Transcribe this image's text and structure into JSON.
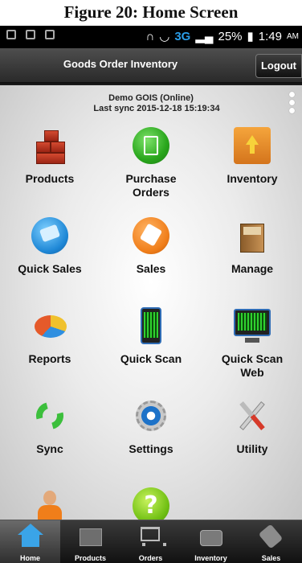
{
  "caption": "Figure 20: Home Screen",
  "statusbar": {
    "network": "3G",
    "battery": "25%",
    "time": "1:49",
    "ampm": "AM"
  },
  "header": {
    "title": "Goods Order Inventory",
    "logout_label": "Logout"
  },
  "account": {
    "line1": "Demo  GOIS (Online)",
    "line2": "Last sync 2015-12-18 15:19:34"
  },
  "tiles": [
    {
      "label": "Products",
      "icon": "boxes-icon"
    },
    {
      "label": "Purchase\nOrders",
      "icon": "calculator-icon"
    },
    {
      "label": "Inventory",
      "icon": "box-arrow-icon"
    },
    {
      "label": "Quick Sales",
      "icon": "sale-tag-icon"
    },
    {
      "label": "Sales",
      "icon": "price-tag-icon"
    },
    {
      "label": "Manage",
      "icon": "cabinet-icon"
    },
    {
      "label": "Reports",
      "icon": "pie-chart-icon"
    },
    {
      "label": "Quick Scan",
      "icon": "barcode-scanner-icon"
    },
    {
      "label": "Quick Scan\nWeb",
      "icon": "barcode-monitor-icon"
    },
    {
      "label": "Sync",
      "icon": "sync-icon"
    },
    {
      "label": "Settings",
      "icon": "gear-icon"
    },
    {
      "label": "Utility",
      "icon": "tools-icon"
    }
  ],
  "bottom_nav": [
    {
      "label": "Home",
      "icon": "home-icon",
      "active": true
    },
    {
      "label": "Products",
      "icon": "box-icon"
    },
    {
      "label": "Orders",
      "icon": "cart-icon"
    },
    {
      "label": "Inventory",
      "icon": "tray-icon"
    },
    {
      "label": "Sales",
      "icon": "tag-icon"
    }
  ],
  "colors": {
    "titlebar": "#3a3a3a",
    "accent": "#3aa4e8"
  }
}
